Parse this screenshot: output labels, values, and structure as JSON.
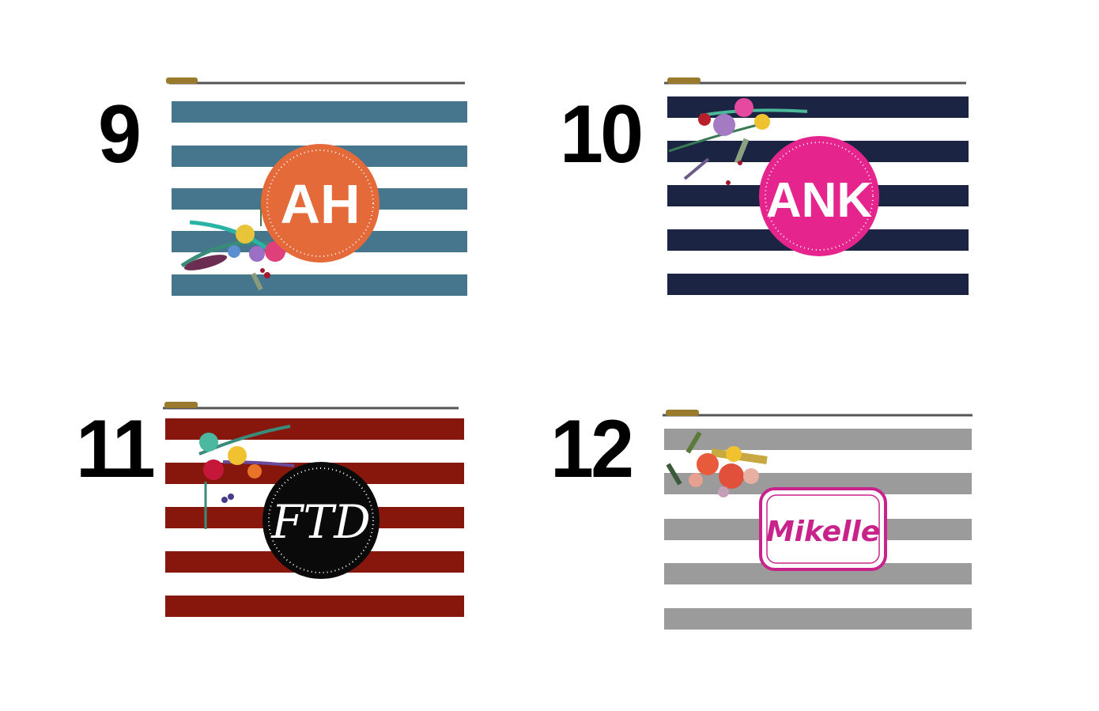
{
  "products": [
    {
      "number": "9",
      "monogram": "AH",
      "stripe_color": "#45768e",
      "badge_color": "#e56a3a",
      "badge_style": "circle-block"
    },
    {
      "number": "10",
      "monogram": "ANK",
      "stripe_color": "#1b2443",
      "badge_color": "#e6248d",
      "badge_style": "circle-block"
    },
    {
      "number": "11",
      "monogram": "FTD",
      "stripe_color": "#87170d",
      "badge_color": "#0a0a0a",
      "badge_style": "circle-script"
    },
    {
      "number": "12",
      "monogram": "Mikelle",
      "stripe_color": "#9b9b9b",
      "badge_color": "#c8238a",
      "badge_style": "name-plate"
    }
  ]
}
